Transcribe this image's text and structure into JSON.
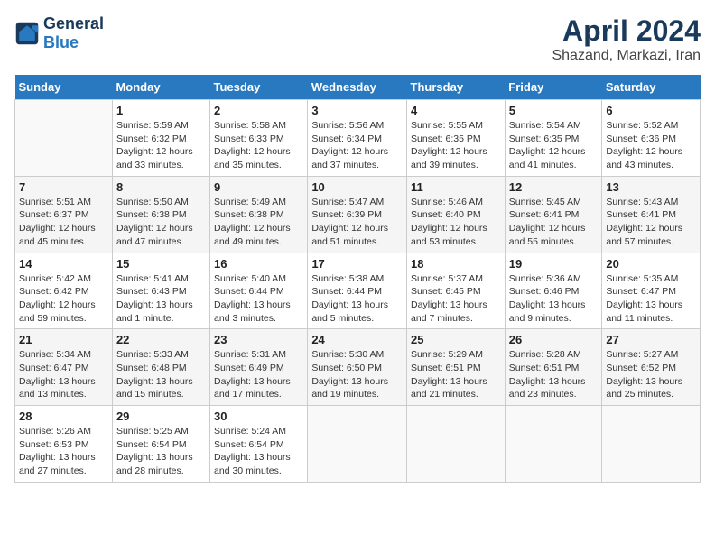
{
  "header": {
    "logo_general": "General",
    "logo_blue": "Blue",
    "title": "April 2024",
    "subtitle": "Shazand, Markazi, Iran"
  },
  "weekdays": [
    "Sunday",
    "Monday",
    "Tuesday",
    "Wednesday",
    "Thursday",
    "Friday",
    "Saturday"
  ],
  "weeks": [
    [
      {
        "num": "",
        "info": ""
      },
      {
        "num": "1",
        "info": "Sunrise: 5:59 AM\nSunset: 6:32 PM\nDaylight: 12 hours\nand 33 minutes."
      },
      {
        "num": "2",
        "info": "Sunrise: 5:58 AM\nSunset: 6:33 PM\nDaylight: 12 hours\nand 35 minutes."
      },
      {
        "num": "3",
        "info": "Sunrise: 5:56 AM\nSunset: 6:34 PM\nDaylight: 12 hours\nand 37 minutes."
      },
      {
        "num": "4",
        "info": "Sunrise: 5:55 AM\nSunset: 6:35 PM\nDaylight: 12 hours\nand 39 minutes."
      },
      {
        "num": "5",
        "info": "Sunrise: 5:54 AM\nSunset: 6:35 PM\nDaylight: 12 hours\nand 41 minutes."
      },
      {
        "num": "6",
        "info": "Sunrise: 5:52 AM\nSunset: 6:36 PM\nDaylight: 12 hours\nand 43 minutes."
      }
    ],
    [
      {
        "num": "7",
        "info": "Sunrise: 5:51 AM\nSunset: 6:37 PM\nDaylight: 12 hours\nand 45 minutes."
      },
      {
        "num": "8",
        "info": "Sunrise: 5:50 AM\nSunset: 6:38 PM\nDaylight: 12 hours\nand 47 minutes."
      },
      {
        "num": "9",
        "info": "Sunrise: 5:49 AM\nSunset: 6:38 PM\nDaylight: 12 hours\nand 49 minutes."
      },
      {
        "num": "10",
        "info": "Sunrise: 5:47 AM\nSunset: 6:39 PM\nDaylight: 12 hours\nand 51 minutes."
      },
      {
        "num": "11",
        "info": "Sunrise: 5:46 AM\nSunset: 6:40 PM\nDaylight: 12 hours\nand 53 minutes."
      },
      {
        "num": "12",
        "info": "Sunrise: 5:45 AM\nSunset: 6:41 PM\nDaylight: 12 hours\nand 55 minutes."
      },
      {
        "num": "13",
        "info": "Sunrise: 5:43 AM\nSunset: 6:41 PM\nDaylight: 12 hours\nand 57 minutes."
      }
    ],
    [
      {
        "num": "14",
        "info": "Sunrise: 5:42 AM\nSunset: 6:42 PM\nDaylight: 12 hours\nand 59 minutes."
      },
      {
        "num": "15",
        "info": "Sunrise: 5:41 AM\nSunset: 6:43 PM\nDaylight: 13 hours\nand 1 minute."
      },
      {
        "num": "16",
        "info": "Sunrise: 5:40 AM\nSunset: 6:44 PM\nDaylight: 13 hours\nand 3 minutes."
      },
      {
        "num": "17",
        "info": "Sunrise: 5:38 AM\nSunset: 6:44 PM\nDaylight: 13 hours\nand 5 minutes."
      },
      {
        "num": "18",
        "info": "Sunrise: 5:37 AM\nSunset: 6:45 PM\nDaylight: 13 hours\nand 7 minutes."
      },
      {
        "num": "19",
        "info": "Sunrise: 5:36 AM\nSunset: 6:46 PM\nDaylight: 13 hours\nand 9 minutes."
      },
      {
        "num": "20",
        "info": "Sunrise: 5:35 AM\nSunset: 6:47 PM\nDaylight: 13 hours\nand 11 minutes."
      }
    ],
    [
      {
        "num": "21",
        "info": "Sunrise: 5:34 AM\nSunset: 6:47 PM\nDaylight: 13 hours\nand 13 minutes."
      },
      {
        "num": "22",
        "info": "Sunrise: 5:33 AM\nSunset: 6:48 PM\nDaylight: 13 hours\nand 15 minutes."
      },
      {
        "num": "23",
        "info": "Sunrise: 5:31 AM\nSunset: 6:49 PM\nDaylight: 13 hours\nand 17 minutes."
      },
      {
        "num": "24",
        "info": "Sunrise: 5:30 AM\nSunset: 6:50 PM\nDaylight: 13 hours\nand 19 minutes."
      },
      {
        "num": "25",
        "info": "Sunrise: 5:29 AM\nSunset: 6:51 PM\nDaylight: 13 hours\nand 21 minutes."
      },
      {
        "num": "26",
        "info": "Sunrise: 5:28 AM\nSunset: 6:51 PM\nDaylight: 13 hours\nand 23 minutes."
      },
      {
        "num": "27",
        "info": "Sunrise: 5:27 AM\nSunset: 6:52 PM\nDaylight: 13 hours\nand 25 minutes."
      }
    ],
    [
      {
        "num": "28",
        "info": "Sunrise: 5:26 AM\nSunset: 6:53 PM\nDaylight: 13 hours\nand 27 minutes."
      },
      {
        "num": "29",
        "info": "Sunrise: 5:25 AM\nSunset: 6:54 PM\nDaylight: 13 hours\nand 28 minutes."
      },
      {
        "num": "30",
        "info": "Sunrise: 5:24 AM\nSunset: 6:54 PM\nDaylight: 13 hours\nand 30 minutes."
      },
      {
        "num": "",
        "info": ""
      },
      {
        "num": "",
        "info": ""
      },
      {
        "num": "",
        "info": ""
      },
      {
        "num": "",
        "info": ""
      }
    ]
  ]
}
